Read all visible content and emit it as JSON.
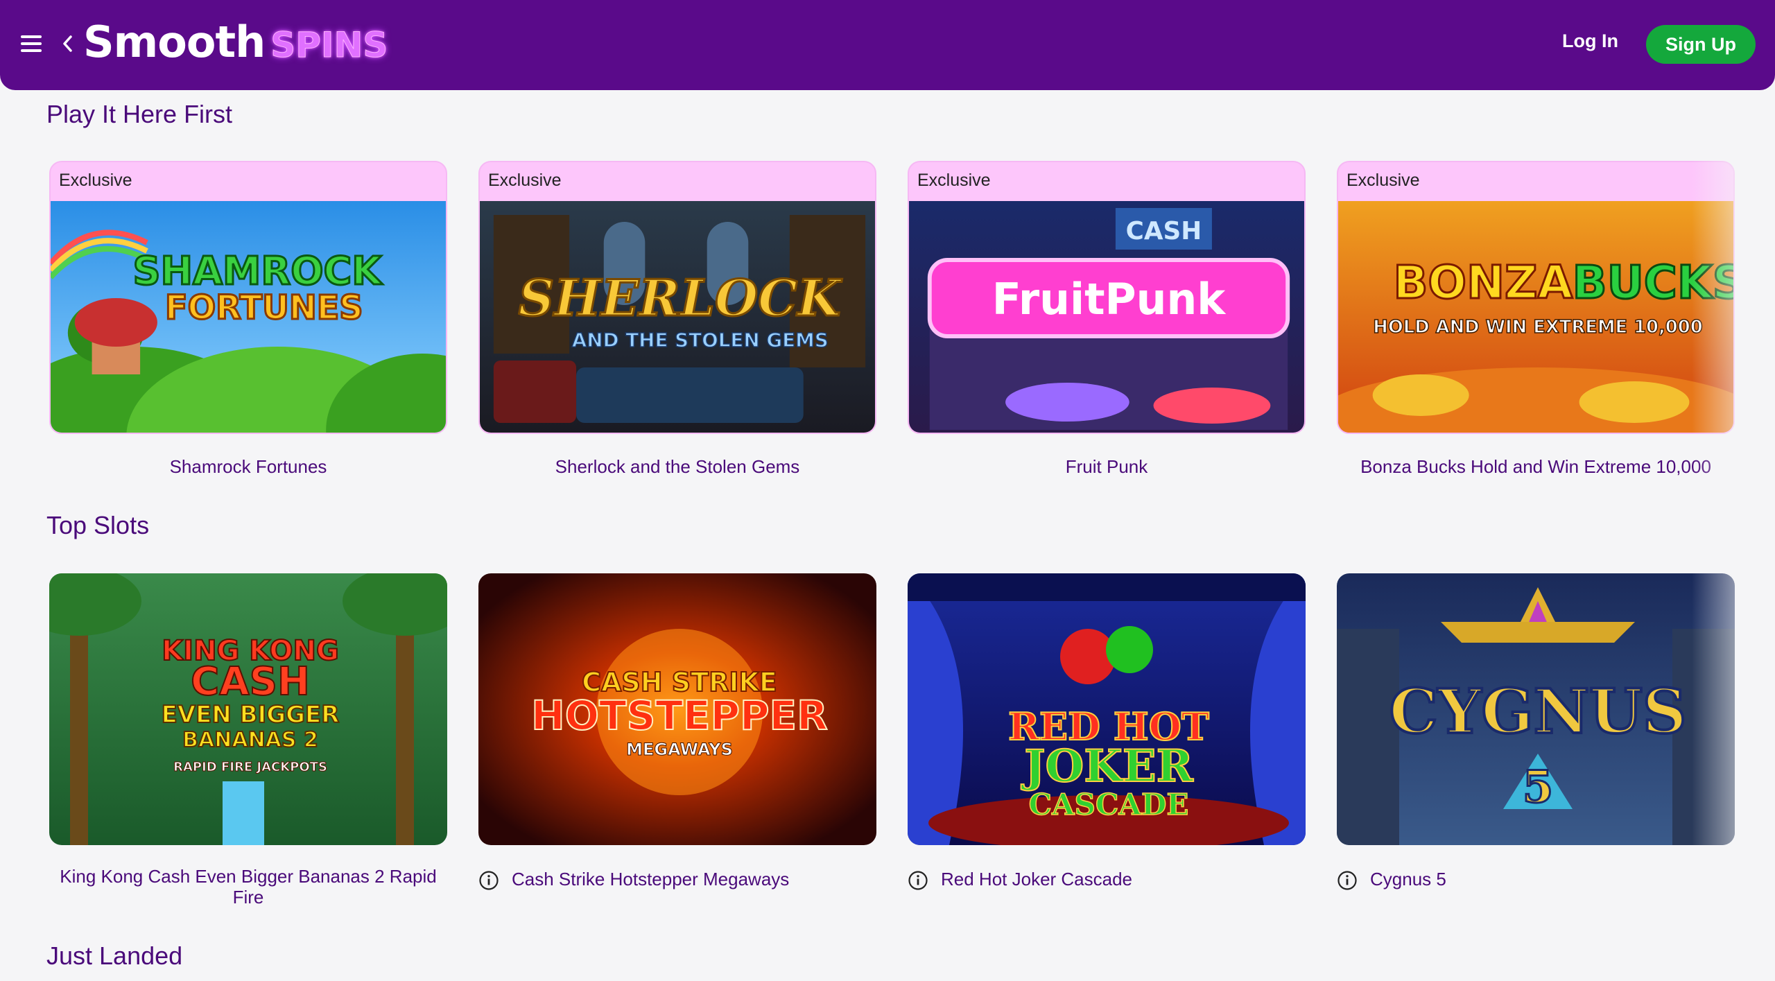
{
  "header": {
    "logo_main": "Smooth",
    "logo_accent": "SPINS",
    "login_label": "Log In",
    "signup_label": "Sign Up"
  },
  "sections": {
    "play_first": {
      "title": "Play It Here First",
      "badge": "Exclusive",
      "games": [
        {
          "title": "Shamrock Fortunes",
          "art": [
            "SHAMROCK",
            "FORTUNES"
          ]
        },
        {
          "title": "Sherlock and the Stolen Gems",
          "art": [
            "SHERLOCK",
            "AND THE STOLEN GEMS"
          ]
        },
        {
          "title": "Fruit Punk",
          "art": [
            "FruitPunk",
            "CASH"
          ]
        },
        {
          "title": "Bonza Bucks Hold and Win Extreme 10,000",
          "art": [
            "BONZA BUCKS",
            "HOLD AND WIN EXTREME 10,000"
          ]
        }
      ]
    },
    "top_slots": {
      "title": "Top Slots",
      "games": [
        {
          "title": "King Kong Cash Even Bigger Bananas 2 Rapid Fire",
          "art": [
            "KING KONG",
            "CASH",
            "EVEN BIGGER",
            "BANANAS 2",
            "RAPID FIRE JACKPOTS"
          ]
        },
        {
          "title": "Cash Strike Hotstepper Megaways",
          "art": [
            "CASH STRIKE",
            "HOTSTEPPER",
            "MEGAWAYS"
          ]
        },
        {
          "title": "Red Hot Joker Cascade",
          "art": [
            "RED HOT",
            "JOKER",
            "CASCADE"
          ]
        },
        {
          "title": "Cygnus 5",
          "art": [
            "CYGNUS",
            "5"
          ]
        }
      ]
    },
    "just_landed": {
      "title": "Just Landed"
    }
  },
  "colors": {
    "header_bg": "#5a0a8a",
    "accent_purple": "#4a0a7a",
    "signup_green": "#14a83c",
    "exclusive_pink": "#fdc6fb"
  },
  "icons": [
    "menu-icon",
    "chevron-left-icon",
    "info-icon"
  ]
}
